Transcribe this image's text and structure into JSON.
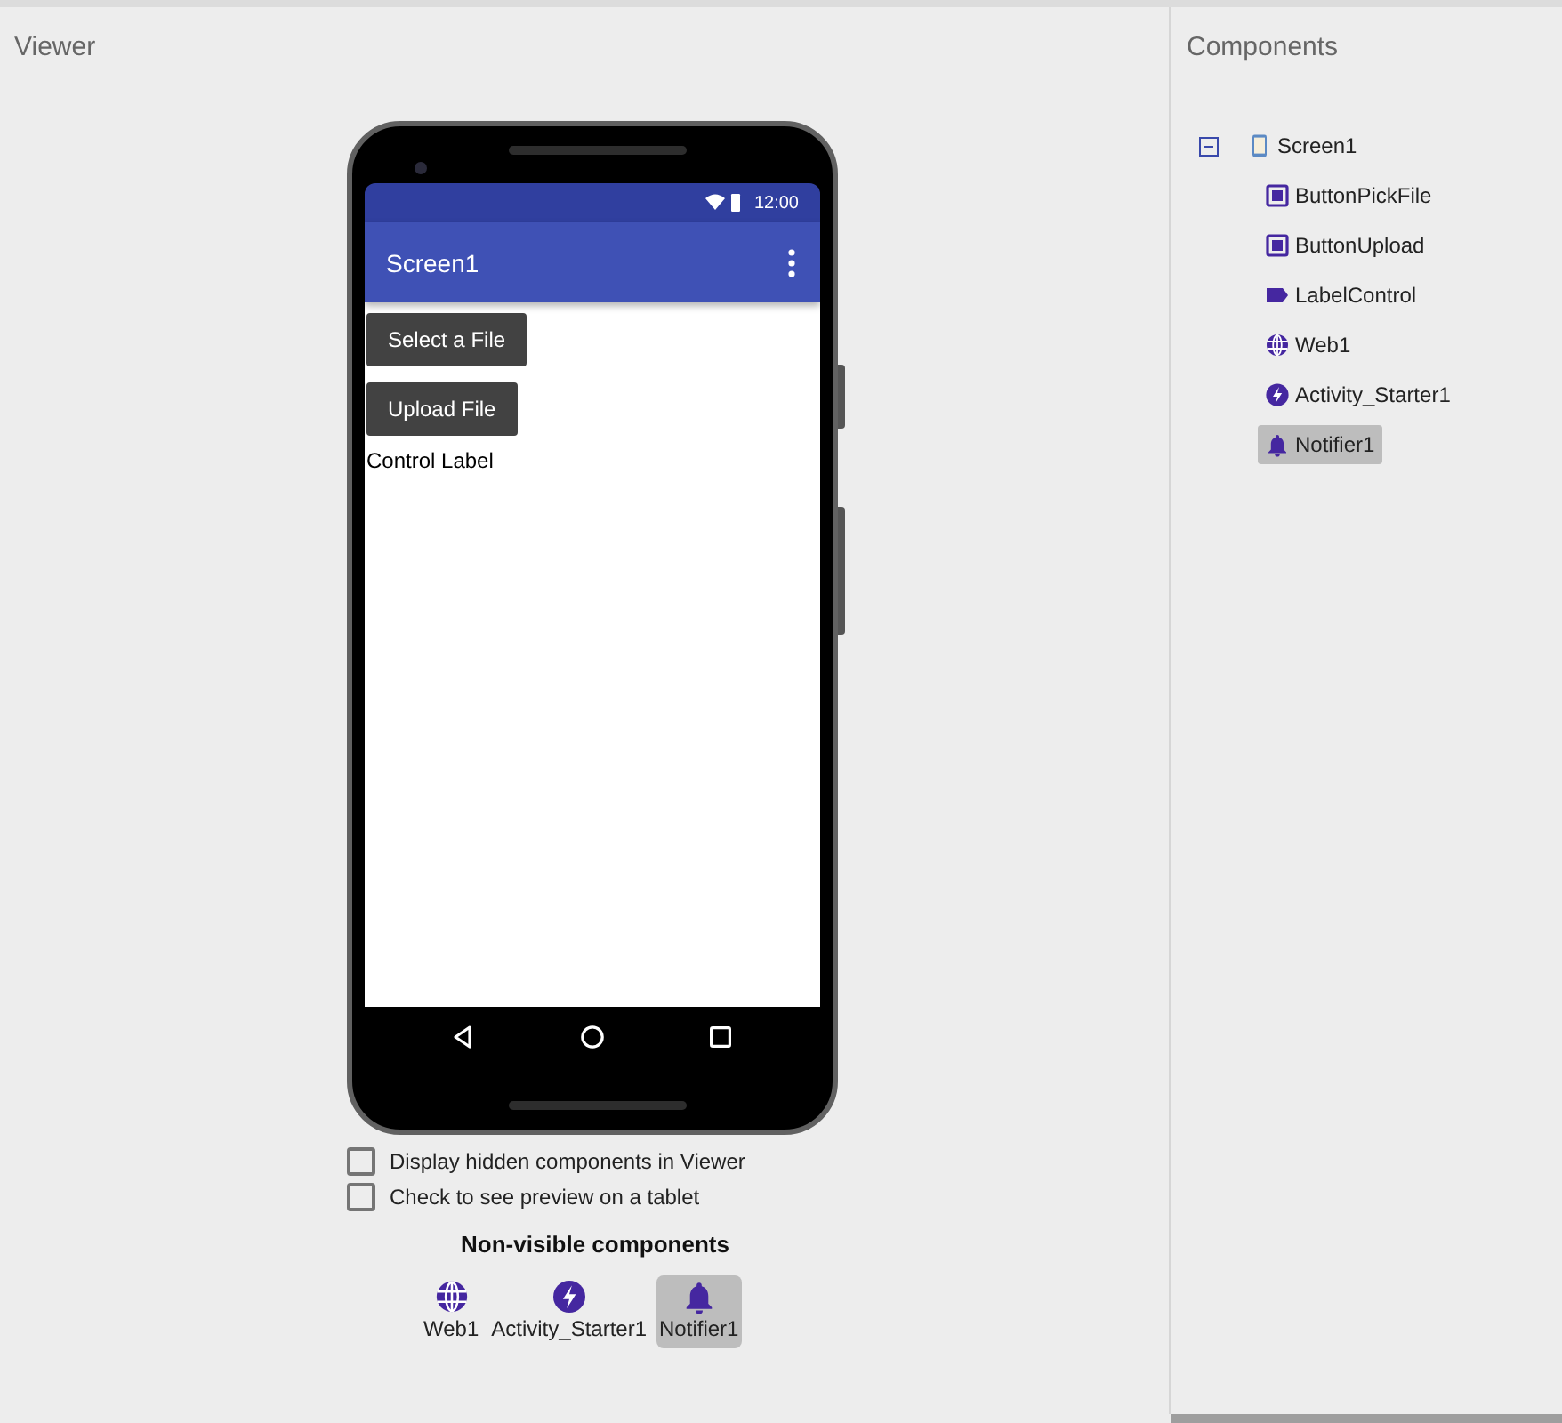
{
  "viewer": {
    "title": "Viewer",
    "phone": {
      "status_time": "12:00",
      "app_title": "Screen1",
      "components": [
        {
          "kind": "button",
          "text": "Select a File"
        },
        {
          "kind": "button",
          "text": "Upload File"
        },
        {
          "kind": "label",
          "text": "Control Label"
        }
      ]
    },
    "checkboxes": [
      {
        "label": "Display hidden components in Viewer",
        "checked": false
      },
      {
        "label": "Check to see preview on a tablet",
        "checked": false
      }
    ],
    "non_visible": {
      "title": "Non-visible components",
      "items": [
        {
          "kind": "web",
          "label": "Web1",
          "selected": false
        },
        {
          "kind": "activity",
          "label": "Activity_Starter1",
          "selected": false
        },
        {
          "kind": "notifier",
          "label": "Notifier1",
          "selected": true
        }
      ]
    }
  },
  "components": {
    "title": "Components",
    "tree": {
      "kind": "screen",
      "label": "Screen1",
      "expanded": true,
      "selected": false,
      "children": [
        {
          "kind": "button",
          "label": "ButtonPickFile",
          "selected": false
        },
        {
          "kind": "button",
          "label": "ButtonUpload",
          "selected": false
        },
        {
          "kind": "label",
          "label": "LabelControl",
          "selected": false
        },
        {
          "kind": "web",
          "label": "Web1",
          "selected": false
        },
        {
          "kind": "activity",
          "label": "Activity_Starter1",
          "selected": false
        },
        {
          "kind": "notifier",
          "label": "Notifier1",
          "selected": true
        }
      ]
    }
  }
}
